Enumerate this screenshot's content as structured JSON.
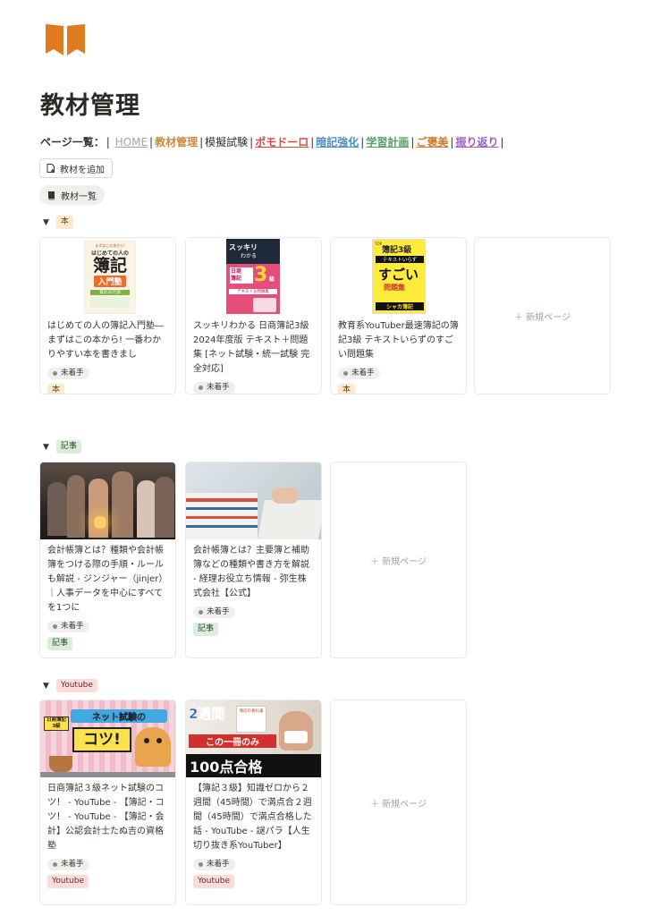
{
  "page": {
    "icon": "open-book-icon",
    "title": "教材管理"
  },
  "nav": {
    "label": "ページ一覧：",
    "separator": "|",
    "links": [
      {
        "label": "HOME",
        "color": "#a8a29e"
      },
      {
        "label": "教材管理",
        "color": "#c8893f"
      },
      {
        "label": "模擬試験",
        "color": "#37352f"
      },
      {
        "label": "ポモドーロ",
        "color": "#e0443e"
      },
      {
        "label": "暗記強化",
        "color": "#4f8dc9"
      },
      {
        "label": "学習計画",
        "color": "#5aa068"
      },
      {
        "label": "ご褒美",
        "color": "#d2782e"
      },
      {
        "label": "振り返り",
        "color": "#9a61c4"
      }
    ]
  },
  "toolbar": {
    "add_label": "教材を追加",
    "view_label": "教材一覧"
  },
  "groups": [
    {
      "tag": "本",
      "cards": [
        {
          "title": "はじめての人の簿記入門塾―まずはこの本から! 一番わかりやすい本を書きまし",
          "status": "未着手",
          "tag": "本"
        },
        {
          "title": "スッキリわかる 日商簿記3級 2024年度版 テキスト＋問題集 [ネット試験・統一試験 完全対応]",
          "status": "未着手",
          "tag": "本"
        },
        {
          "title": "教育系YouTuber最速簿記の簿記3級 テキストいらずのすごい問題集",
          "status": "未着手",
          "tag": "本"
        }
      ],
      "new_label": "＋ 新規ページ"
    },
    {
      "tag": "記事",
      "cards": [
        {
          "title": "会計帳簿とは？種類や会計帳簿をつける際の手順・ルールも解説 - ジンジャー（jinjer）｜人事データを中心にすべてを1つに",
          "status": "未着手",
          "tag": "記事"
        },
        {
          "title": "会計帳簿とは？主要簿と補助簿などの種類や書き方を解説 - 経理お役立ち情報 - 弥生株式会社【公式】",
          "status": "未着手",
          "tag": "記事"
        }
      ],
      "new_label": "＋ 新規ページ"
    },
    {
      "tag": "Youtube",
      "cards": [
        {
          "title": "日商簿記３級ネット試験のコツ！ - YouTube - 【簿記・コツ！ - YouTube - 【簿記・会計】公認会計士たぬ吉の資格塾",
          "status": "未着手",
          "tag": "Youtube"
        },
        {
          "title": "【簿記３級】知識ゼロから２週間（45時間）で満点合２週間（45時間）で満点合格した話 - YouTube - 謎パラ【人生切り抜き系YouTuber】",
          "status": "未着手",
          "tag": "Youtube"
        }
      ],
      "new_label": "＋ 新規ページ"
    }
  ],
  "covers": {
    "book1": {
      "top": "まずはこの本から!",
      "title1": "はじめての人の",
      "title2": "簿記",
      "badge": "入門塾",
      "sub": "累計20万部"
    },
    "book2": {
      "title1": "スッキリ",
      "title2": "わかる",
      "line1": "日商",
      "line2": "簿記",
      "num": "3",
      "unit": "級",
      "foot": "テキスト＆問題集"
    },
    "book3": {
      "corner": "TOP",
      "title1": "簿記3級",
      "line": "テキストいらず",
      "big": "すごい",
      "sub": "問題集",
      "foot": "シャカ簿記"
    },
    "yt1": {
      "badge1": "日商簿記",
      "badge2": "3級",
      "title": "ネット試験の",
      "big": "コツ!"
    },
    "yt2": {
      "title": "2週間",
      "book": "簿記の教科書",
      "banner": "この一冊のみ",
      "big": "100点合格"
    }
  },
  "colors": {
    "book_tag": "#fbeacb",
    "article_tag": "#dbeddb",
    "youtube_tag": "#fbdcdc",
    "icon": "#e07b1f"
  }
}
